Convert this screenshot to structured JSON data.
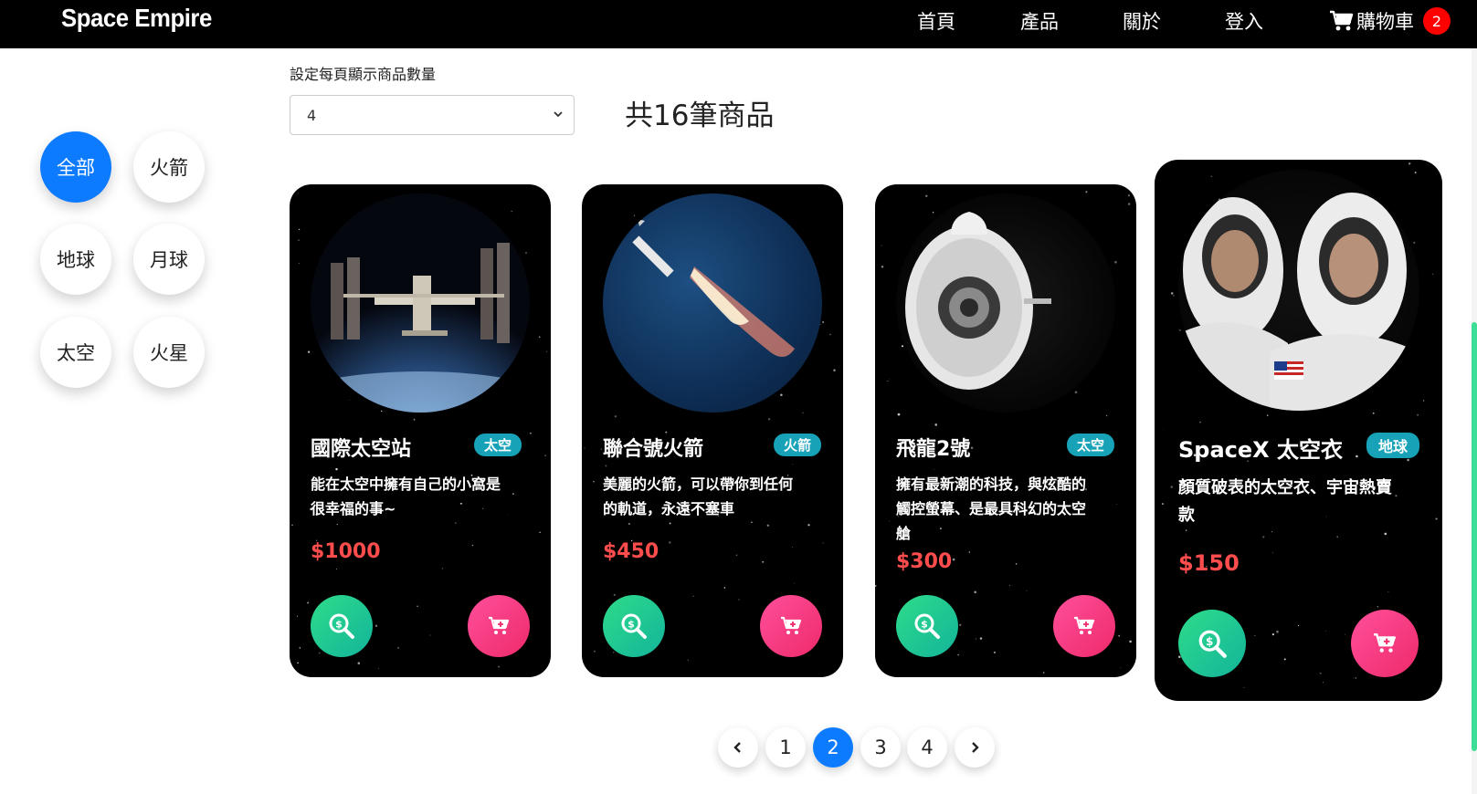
{
  "navbar": {
    "brand": "Space Empire",
    "links": [
      "首頁",
      "產品",
      "關於",
      "登入"
    ],
    "cart_label": "購物車",
    "cart_count": "2",
    "cart_icon": "shopping-cart-icon"
  },
  "categories": [
    {
      "label": "全部",
      "active": true
    },
    {
      "label": "火箭",
      "active": false
    },
    {
      "label": "地球",
      "active": false
    },
    {
      "label": "月球",
      "active": false
    },
    {
      "label": "太空",
      "active": false
    },
    {
      "label": "火星",
      "active": false
    }
  ],
  "page_size": {
    "label": "設定每頁顯示商品數量",
    "value": "4"
  },
  "total": "共16筆商品",
  "products": [
    {
      "title": "國際太空站",
      "tag": "太空",
      "desc_lines": [
        "能在太空中擁有自己的小窩是",
        "很幸福的事~"
      ],
      "price": "$1000",
      "image": "space-station"
    },
    {
      "title": "聯合號火箭",
      "tag": "火箭",
      "desc_lines": [
        "美麗的火箭，可以帶你到任何",
        "的軌道，永遠不塞車"
      ],
      "price": "$450",
      "image": "rocket"
    },
    {
      "title": "飛龍2號",
      "tag": "太空",
      "desc_lines": [
        "擁有最新潮的科技，與炫酷的",
        "觸控螢幕、是最具科幻的太空",
        "艙"
      ],
      "price": "$300",
      "image": "dragon-capsule"
    },
    {
      "title": "SpaceX 太空衣",
      "tag": "地球",
      "desc_lines": [
        "顏質破表的太空衣、宇宙熱賣",
        "款"
      ],
      "price": "$150",
      "image": "spacesuits"
    }
  ],
  "pagination": {
    "pages": [
      "1",
      "2",
      "3",
      "4"
    ],
    "current": "2",
    "prev_icon": "chevron-left-icon",
    "next_icon": "chevron-right-icon"
  },
  "colors": {
    "primary": "#0d7bff",
    "tag": "#17a2b8",
    "price": "#ff4d4d",
    "search_btn": "#13b49a",
    "cart_btn": "#ee2a6b",
    "badge": "#ff0000"
  }
}
